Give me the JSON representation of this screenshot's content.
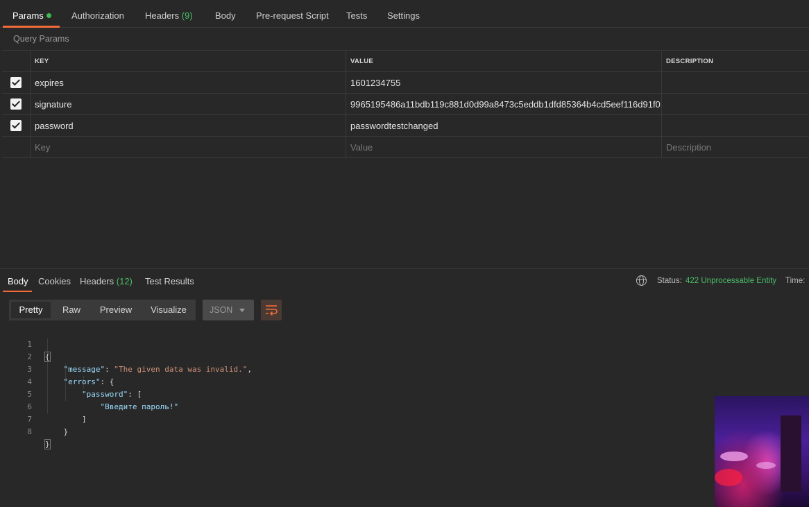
{
  "request_tabs": [
    {
      "label": "Params",
      "count": "",
      "active": true
    },
    {
      "label": "Authorization",
      "count": ""
    },
    {
      "label": "Headers",
      "count": "(9)"
    },
    {
      "label": "Body",
      "count": ""
    },
    {
      "label": "Pre-request Script",
      "count": ""
    },
    {
      "label": "Tests",
      "count": ""
    },
    {
      "label": "Settings",
      "count": ""
    }
  ],
  "query_params_label": "Query Params",
  "params_table": {
    "headers": [
      "KEY",
      "VALUE",
      "DESCRIPTION"
    ],
    "rows": [
      {
        "checked": true,
        "key": "expires",
        "value": "1601234755",
        "description": ""
      },
      {
        "checked": true,
        "key": "signature",
        "value": "9965195486a11bdb119c881d0d99a8473c5eddb1dfd85364b4cd5eef116d91f0",
        "description": ""
      },
      {
        "checked": true,
        "key": "password",
        "value": "passwordtestchanged",
        "description": ""
      }
    ],
    "placeholders": {
      "key": "Key",
      "value": "Value",
      "description": "Description"
    }
  },
  "response_tabs": [
    {
      "label": "Body",
      "count": "",
      "active": true
    },
    {
      "label": "Cookies",
      "count": ""
    },
    {
      "label": "Headers",
      "count": "(12)"
    },
    {
      "label": "Test Results",
      "count": ""
    }
  ],
  "status": {
    "label": "Status:",
    "value": "422 Unprocessable Entity",
    "time_label": "Time:"
  },
  "view_modes": [
    "Pretty",
    "Raw",
    "Preview",
    "Visualize"
  ],
  "active_view_mode": "Pretty",
  "format": "JSON",
  "code_lines": [
    {
      "num": "1",
      "text": "{"
    },
    {
      "num": "2",
      "key": "\"message\"",
      "sep": ": ",
      "val": "\"The given data was invalid.\"",
      "tail": ","
    },
    {
      "num": "3",
      "key": "\"errors\"",
      "sep": ": ",
      "tail": "{"
    },
    {
      "num": "4",
      "key": "\"password\"",
      "sep": ": ",
      "tail": "["
    },
    {
      "num": "5",
      "val": "\"Введите пароль!\""
    },
    {
      "num": "6",
      "text": "]"
    },
    {
      "num": "7",
      "text": "}"
    },
    {
      "num": "8",
      "text": "}"
    }
  ],
  "colors": {
    "accent": "#f26b3a",
    "status_ok": "#4cbf6a",
    "json_key": "#9cdcfe",
    "json_string": "#ce9178"
  },
  "icons": [
    "checkbox-checked-icon",
    "globe-icon",
    "chevron-down-icon",
    "wrap-lines-icon"
  ]
}
